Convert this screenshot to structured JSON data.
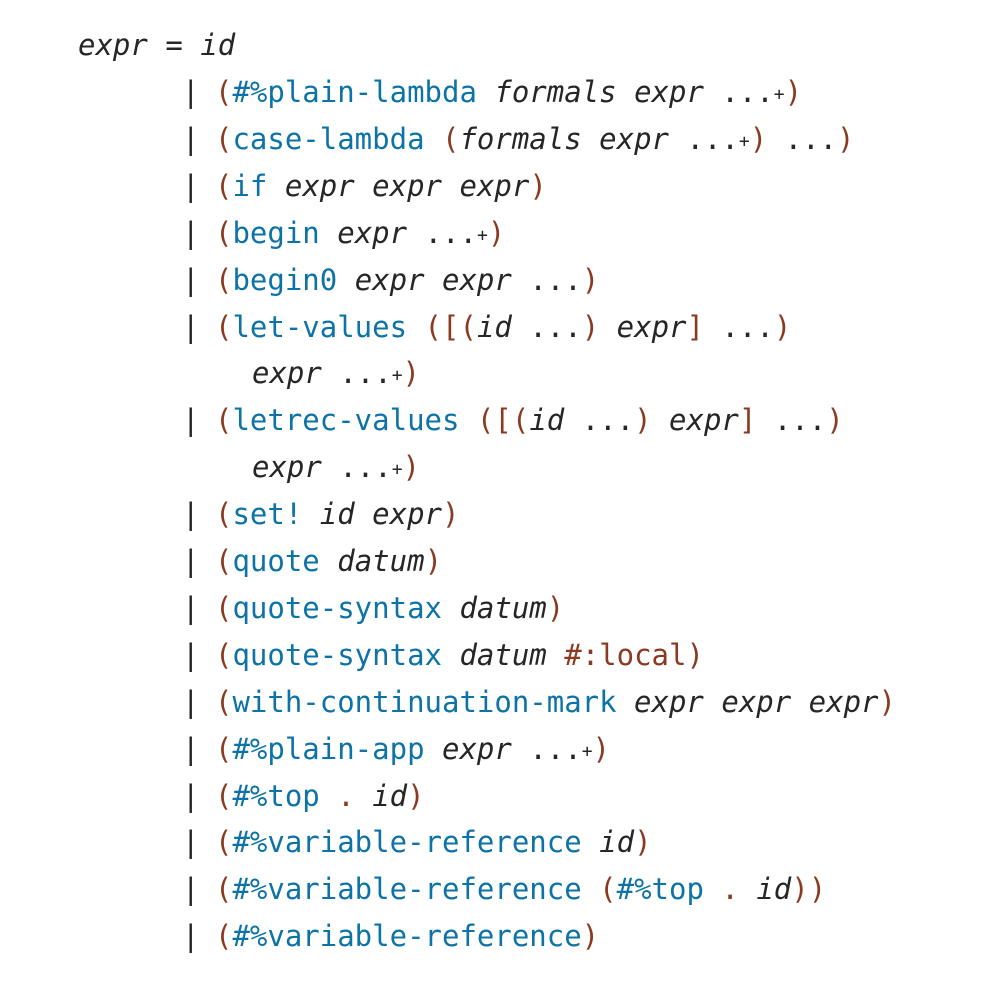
{
  "head": {
    "lhs": "expr",
    "eq": "=",
    "rhs": "id"
  },
  "bar": "|",
  "productions": [
    {
      "segs": [
        [
          "p",
          "("
        ],
        [
          "k",
          "#%plain-lambda"
        ],
        [
          "t",
          " "
        ],
        [
          "m",
          "formals"
        ],
        [
          "t",
          " "
        ],
        [
          "m",
          "expr"
        ],
        [
          "t",
          " "
        ],
        [
          "d",
          "..."
        ],
        [
          "s",
          "+"
        ],
        [
          "p",
          ")"
        ]
      ]
    },
    {
      "segs": [
        [
          "p",
          "("
        ],
        [
          "k",
          "case-lambda"
        ],
        [
          "t",
          " "
        ],
        [
          "p",
          "("
        ],
        [
          "m",
          "formals"
        ],
        [
          "t",
          " "
        ],
        [
          "m",
          "expr"
        ],
        [
          "t",
          " "
        ],
        [
          "d",
          "..."
        ],
        [
          "s",
          "+"
        ],
        [
          "p",
          ")"
        ],
        [
          "t",
          " "
        ],
        [
          "d",
          "..."
        ],
        [
          "p",
          ")"
        ]
      ]
    },
    {
      "segs": [
        [
          "p",
          "("
        ],
        [
          "k",
          "if"
        ],
        [
          "t",
          " "
        ],
        [
          "m",
          "expr"
        ],
        [
          "t",
          " "
        ],
        [
          "m",
          "expr"
        ],
        [
          "t",
          " "
        ],
        [
          "m",
          "expr"
        ],
        [
          "p",
          ")"
        ]
      ]
    },
    {
      "segs": [
        [
          "p",
          "("
        ],
        [
          "k",
          "begin"
        ],
        [
          "t",
          " "
        ],
        [
          "m",
          "expr"
        ],
        [
          "t",
          " "
        ],
        [
          "d",
          "..."
        ],
        [
          "s",
          "+"
        ],
        [
          "p",
          ")"
        ]
      ]
    },
    {
      "segs": [
        [
          "p",
          "("
        ],
        [
          "k",
          "begin0"
        ],
        [
          "t",
          " "
        ],
        [
          "m",
          "expr"
        ],
        [
          "t",
          " "
        ],
        [
          "m",
          "expr"
        ],
        [
          "t",
          " "
        ],
        [
          "d",
          "..."
        ],
        [
          "p",
          ")"
        ]
      ]
    },
    {
      "segs": [
        [
          "p",
          "("
        ],
        [
          "k",
          "let-values"
        ],
        [
          "t",
          " "
        ],
        [
          "p",
          "([("
        ],
        [
          "m",
          "id"
        ],
        [
          "t",
          " "
        ],
        [
          "d",
          "..."
        ],
        [
          "p",
          ")"
        ],
        [
          "t",
          " "
        ],
        [
          "m",
          "expr"
        ],
        [
          "p",
          "]"
        ],
        [
          "t",
          " "
        ],
        [
          "d",
          "..."
        ],
        [
          "p",
          ")"
        ]
      ],
      "cont": [
        [
          "m",
          "expr"
        ],
        [
          "t",
          " "
        ],
        [
          "d",
          "..."
        ],
        [
          "s",
          "+"
        ],
        [
          "p",
          ")"
        ]
      ]
    },
    {
      "segs": [
        [
          "p",
          "("
        ],
        [
          "k",
          "letrec-values"
        ],
        [
          "t",
          " "
        ],
        [
          "p",
          "([("
        ],
        [
          "m",
          "id"
        ],
        [
          "t",
          " "
        ],
        [
          "d",
          "..."
        ],
        [
          "p",
          ")"
        ],
        [
          "t",
          " "
        ],
        [
          "m",
          "expr"
        ],
        [
          "p",
          "]"
        ],
        [
          "t",
          " "
        ],
        [
          "d",
          "..."
        ],
        [
          "p",
          ")"
        ]
      ],
      "cont": [
        [
          "m",
          "expr"
        ],
        [
          "t",
          " "
        ],
        [
          "d",
          "..."
        ],
        [
          "s",
          "+"
        ],
        [
          "p",
          ")"
        ]
      ]
    },
    {
      "segs": [
        [
          "p",
          "("
        ],
        [
          "k",
          "set!"
        ],
        [
          "t",
          " "
        ],
        [
          "m",
          "id"
        ],
        [
          "t",
          " "
        ],
        [
          "m",
          "expr"
        ],
        [
          "p",
          ")"
        ]
      ]
    },
    {
      "segs": [
        [
          "p",
          "("
        ],
        [
          "k",
          "quote"
        ],
        [
          "t",
          " "
        ],
        [
          "m",
          "datum"
        ],
        [
          "p",
          ")"
        ]
      ]
    },
    {
      "segs": [
        [
          "p",
          "("
        ],
        [
          "k",
          "quote-syntax"
        ],
        [
          "t",
          " "
        ],
        [
          "m",
          "datum"
        ],
        [
          "p",
          ")"
        ]
      ]
    },
    {
      "segs": [
        [
          "p",
          "("
        ],
        [
          "k",
          "quote-syntax"
        ],
        [
          "t",
          " "
        ],
        [
          "m",
          "datum"
        ],
        [
          "t",
          " "
        ],
        [
          "p",
          "#:local"
        ],
        [
          "p",
          ")"
        ]
      ]
    },
    {
      "segs": [
        [
          "p",
          "("
        ],
        [
          "k",
          "with-continuation-mark"
        ],
        [
          "t",
          " "
        ],
        [
          "m",
          "expr"
        ],
        [
          "t",
          " "
        ],
        [
          "m",
          "expr"
        ],
        [
          "t",
          " "
        ],
        [
          "m",
          "expr"
        ],
        [
          "p",
          ")"
        ]
      ]
    },
    {
      "segs": [
        [
          "p",
          "("
        ],
        [
          "k",
          "#%plain-app"
        ],
        [
          "t",
          " "
        ],
        [
          "m",
          "expr"
        ],
        [
          "t",
          " "
        ],
        [
          "d",
          "..."
        ],
        [
          "s",
          "+"
        ],
        [
          "p",
          ")"
        ]
      ]
    },
    {
      "segs": [
        [
          "p",
          "("
        ],
        [
          "k",
          "#%top"
        ],
        [
          "t",
          " "
        ],
        [
          "p",
          "."
        ],
        [
          "t",
          " "
        ],
        [
          "m",
          "id"
        ],
        [
          "p",
          ")"
        ]
      ]
    },
    {
      "segs": [
        [
          "p",
          "("
        ],
        [
          "k",
          "#%variable-reference"
        ],
        [
          "t",
          " "
        ],
        [
          "m",
          "id"
        ],
        [
          "p",
          ")"
        ]
      ]
    },
    {
      "segs": [
        [
          "p",
          "("
        ],
        [
          "k",
          "#%variable-reference"
        ],
        [
          "t",
          " "
        ],
        [
          "p",
          "("
        ],
        [
          "k",
          "#%top"
        ],
        [
          "t",
          " "
        ],
        [
          "p",
          "."
        ],
        [
          "t",
          " "
        ],
        [
          "m",
          "id"
        ],
        [
          "p",
          "))"
        ]
      ]
    },
    {
      "segs": [
        [
          "p",
          "("
        ],
        [
          "k",
          "#%variable-reference"
        ],
        [
          "p",
          ")"
        ]
      ]
    }
  ]
}
